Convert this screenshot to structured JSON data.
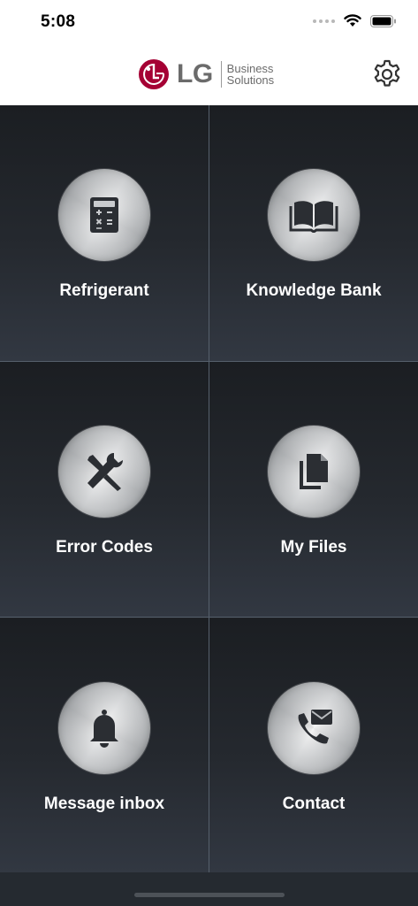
{
  "status_bar": {
    "time": "5:08"
  },
  "header": {
    "logo_mark": "LG",
    "logo_sub_line1": "Business",
    "logo_sub_line2": "Solutions",
    "settings_icon": "gear-icon"
  },
  "tiles": [
    {
      "label": "Refrigerant",
      "icon": "calculator-icon"
    },
    {
      "label": "Knowledge Bank",
      "icon": "book-icon"
    },
    {
      "label": "Error Codes",
      "icon": "tools-icon"
    },
    {
      "label": "My Files",
      "icon": "files-icon"
    },
    {
      "label": "Message inbox",
      "icon": "bell-icon"
    },
    {
      "label": "Contact",
      "icon": "phone-mail-icon"
    }
  ],
  "colors": {
    "brand": "#a50034",
    "tile_text": "#ffffff",
    "divider": "#56606c"
  }
}
